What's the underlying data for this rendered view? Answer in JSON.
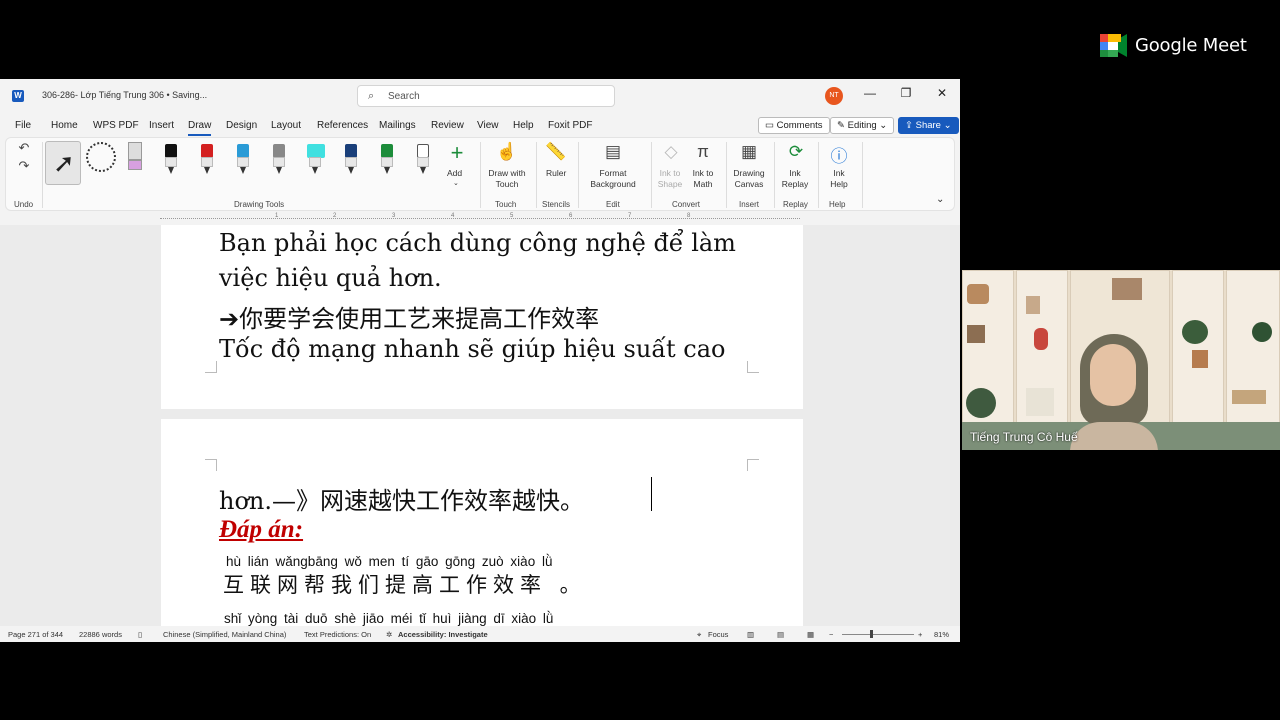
{
  "meet": {
    "brand": "Google Meet"
  },
  "word": {
    "doc_title": "306-286- Lớp Tiếng Trung 306 • Saving...",
    "search_placeholder": "Search",
    "avatar_initials": "NT",
    "menu": [
      "File",
      "Home",
      "WPS PDF",
      "Insert",
      "Draw",
      "Design",
      "Layout",
      "References",
      "Mailings",
      "Review",
      "View",
      "Help",
      "Foxit PDF"
    ],
    "active_menu": "Draw",
    "right_buttons": {
      "comments": "Comments",
      "editing": "Editing",
      "share": "Share"
    },
    "ribbon": {
      "undo_group": "Undo",
      "drawing_tools_group": "Drawing Tools",
      "add_label": "Add",
      "draw_with_touch": "Draw with\nTouch",
      "touch_group": "Touch",
      "ruler": "Ruler",
      "stencils_group": "Stencils",
      "format_background": "Format\nBackground",
      "edit_group": "Edit",
      "ink_to_shape": "Ink to\nShape",
      "ink_to_math": "Ink to\nMath",
      "convert_group": "Convert",
      "drawing_canvas": "Drawing\nCanvas",
      "insert_group": "Insert",
      "ink_replay": "Ink\nReplay",
      "replay_group": "Replay",
      "ink_help": "Ink\nHelp",
      "help_group": "Help",
      "pen_colors": [
        "#111111",
        "#d32020",
        "#2a9bd6",
        "#888888",
        "#40e0e0",
        "#1a3f7a",
        "#1c8c3a",
        "#ffffff"
      ]
    },
    "ruler_marks": [
      "1",
      "2",
      "3",
      "4",
      "5",
      "6",
      "7",
      "8"
    ],
    "page1_lines": [
      "Bạn phải học cách dùng công nghệ để làm",
      "việc hiệu quả hơn.",
      "➔你要学会使用工艺来提高工作效率",
      "Tốc độ mạng nhanh sẽ giúp hiệu suất cao"
    ],
    "page2": {
      "line1": "hơn.—》网速越快工作效率越快。",
      "answer_label": "Đáp án:",
      "pinyin1": "hù  lián wǎngbāng wǒ men  tí   gāo gōng zuò xiào  lǜ",
      "hanzi1": "互联网帮我们提高工作效率 。",
      "pinyin2": "shǐ yòng tài  duō shè jiāo méi   tǐ    huì jiàng  dī  xiào  lǜ"
    },
    "status": {
      "page": "Page 271 of 344",
      "words": "22886 words",
      "language": "Chinese (Simplified, Mainland China)",
      "predictions": "Text Predictions: On",
      "accessibility": "Accessibility: Investigate",
      "focus": "Focus",
      "zoom": "81%"
    }
  },
  "participant": {
    "name": "Tiếng Trung Cô Huế"
  }
}
